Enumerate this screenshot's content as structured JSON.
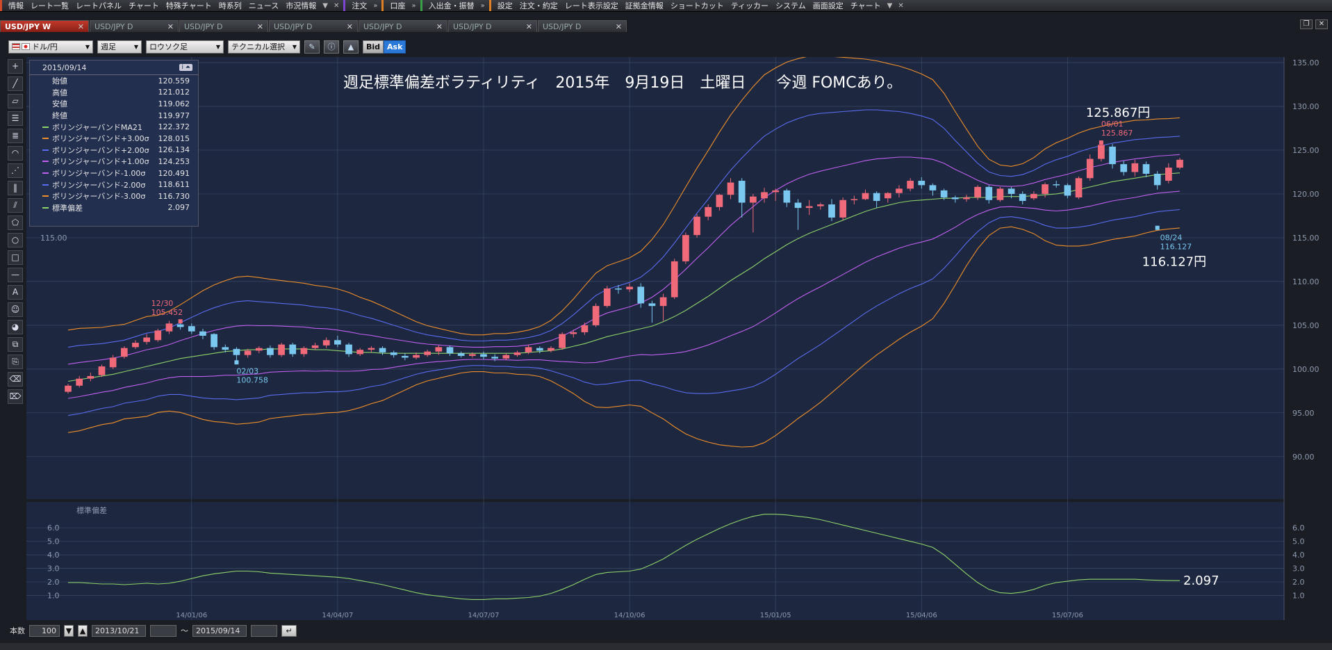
{
  "menubar": {
    "groups": [
      {
        "items": [
          "情報",
          "レート一覧",
          "レートパネル",
          "チャート",
          "特殊チャート",
          "時系列",
          "ニュース",
          "市況情報"
        ]
      },
      {
        "items": [
          "注文"
        ]
      },
      {
        "items": [
          "口座"
        ]
      },
      {
        "items": [
          "入出金・振替"
        ]
      },
      {
        "items": [
          "設定",
          "注文・約定",
          "レート表示設定",
          "証拠金情報",
          "ショートカット",
          "ティッカー",
          "システム",
          "画面設定",
          "チャート"
        ]
      }
    ]
  },
  "tabs": [
    {
      "label": "USD/JPY W",
      "active": true
    },
    {
      "label": "USD/JPY D",
      "active": false
    },
    {
      "label": "USD/JPY D",
      "active": false
    },
    {
      "label": "USD/JPY D",
      "active": false
    },
    {
      "label": "USD/JPY D",
      "active": false
    },
    {
      "label": "USD/JPY D",
      "active": false
    },
    {
      "label": "USD/JPY D",
      "active": false
    }
  ],
  "toolbar": {
    "pair": "ドル/円",
    "period": "週足",
    "chart_style": "ロウソク足",
    "technical": "テクニカル選択",
    "bid_label": "Bid",
    "ask_label": "Ask"
  },
  "infobox": {
    "date": "2015/09/14",
    "rows": [
      {
        "label": "始値",
        "value": "120.559",
        "color": ""
      },
      {
        "label": "高値",
        "value": "121.012",
        "color": ""
      },
      {
        "label": "安値",
        "value": "119.062",
        "color": ""
      },
      {
        "label": "終値",
        "value": "119.977",
        "color": ""
      },
      {
        "label": "ボリンジャーバンドMA21",
        "value": "122.372",
        "color": "#8fd46a"
      },
      {
        "label": "ボリンジャーバンド+3.00σ",
        "value": "128.015",
        "color": "#f0902a"
      },
      {
        "label": "ボリンジャーバンド+2.00σ",
        "value": "126.134",
        "color": "#5a6cf0"
      },
      {
        "label": "ボリンジャーバンド+1.00σ",
        "value": "124.253",
        "color": "#c060f0"
      },
      {
        "label": "ボリンジャーバンド-1.00σ",
        "value": "120.491",
        "color": "#c060f0"
      },
      {
        "label": "ボリンジャーバンド-2.00σ",
        "value": "118.611",
        "color": "#5a6cf0"
      },
      {
        "label": "ボリンジャーバンド-3.00σ",
        "value": "116.730",
        "color": "#f0902a"
      },
      {
        "label": "標準偏差",
        "value": "2.097",
        "color": "#8fd46a"
      }
    ]
  },
  "status": {
    "count_label": "本数",
    "count_value": "100",
    "from_date": "2013/10/21",
    "tilde": "～",
    "to_date": "2015/09/14"
  },
  "chart_data": {
    "type": "candlestick",
    "title": "週足標準偏差ボラティリティ　2015年　9月19日　土曜日　　今週 FOMCあり。",
    "ylim": [
      88,
      135
    ],
    "yticks": [
      "135.00",
      "130.00",
      "125.00",
      "120.00",
      "115.00",
      "110.00",
      "105.00",
      "100.00",
      "95.00",
      "90.00"
    ],
    "xticks": [
      "14/01/06",
      "14/04/07",
      "14/07/07",
      "14/10/06",
      "15/01/05",
      "15/04/06",
      "15/07/06"
    ],
    "candles": [
      [
        97.4,
        98.1,
        97.2,
        98.3
      ],
      [
        98.1,
        98.9,
        97.9,
        99.2
      ],
      [
        98.9,
        99.2,
        98.6,
        99.6
      ],
      [
        99.3,
        100.3,
        99.1,
        100.5
      ],
      [
        100.2,
        101.3,
        100.0,
        101.6
      ],
      [
        101.4,
        102.4,
        101.2,
        102.6
      ],
      [
        102.5,
        103.0,
        102.3,
        103.3
      ],
      [
        103.1,
        103.6,
        102.8,
        104.0
      ],
      [
        103.3,
        104.4,
        103.1,
        104.6
      ],
      [
        104.3,
        105.2,
        104.0,
        105.5
      ],
      [
        105.1,
        104.8,
        104.5,
        105.45
      ],
      [
        104.9,
        104.3,
        104.0,
        105.2
      ],
      [
        104.3,
        103.8,
        103.4,
        104.6
      ],
      [
        104.0,
        102.5,
        102.2,
        104.1
      ],
      [
        102.5,
        102.2,
        101.9,
        102.8
      ],
      [
        102.3,
        101.6,
        100.76,
        102.5
      ],
      [
        101.6,
        102.1,
        101.3,
        102.3
      ],
      [
        102.1,
        102.4,
        101.8,
        102.6
      ],
      [
        102.4,
        101.6,
        101.3,
        102.7
      ],
      [
        101.6,
        102.8,
        101.4,
        103.0
      ],
      [
        102.8,
        101.7,
        101.4,
        103.0
      ],
      [
        101.7,
        102.4,
        101.4,
        102.6
      ],
      [
        102.4,
        102.7,
        102.2,
        103.0
      ],
      [
        102.7,
        103.3,
        102.4,
        103.6
      ],
      [
        103.3,
        102.8,
        102.5,
        103.8
      ],
      [
        102.8,
        101.7,
        101.4,
        103.0
      ],
      [
        101.7,
        102.2,
        101.5,
        102.4
      ],
      [
        102.2,
        102.4,
        101.9,
        102.6
      ],
      [
        102.4,
        101.9,
        101.6,
        102.6
      ],
      [
        101.9,
        101.6,
        101.3,
        102.1
      ],
      [
        101.5,
        101.3,
        101.0,
        101.8
      ],
      [
        101.3,
        101.6,
        101.1,
        101.9
      ],
      [
        101.6,
        102.0,
        101.4,
        102.2
      ],
      [
        102.0,
        102.5,
        101.6,
        102.7
      ],
      [
        102.5,
        101.8,
        101.5,
        102.7
      ],
      [
        101.8,
        101.5,
        101.3,
        102.0
      ],
      [
        101.5,
        101.7,
        101.3,
        101.9
      ],
      [
        101.7,
        101.4,
        101.1,
        102.0
      ],
      [
        101.4,
        101.2,
        100.9,
        101.7
      ],
      [
        101.2,
        101.6,
        101.0,
        101.8
      ],
      [
        101.6,
        101.9,
        101.4,
        102.1
      ],
      [
        101.9,
        102.5,
        101.7,
        102.8
      ],
      [
        102.4,
        102.1,
        101.8,
        102.6
      ],
      [
        102.1,
        102.4,
        101.9,
        102.6
      ],
      [
        102.4,
        104.0,
        102.2,
        104.2
      ],
      [
        104.0,
        104.2,
        103.6,
        104.5
      ],
      [
        104.2,
        105.0,
        103.9,
        105.3
      ],
      [
        105.0,
        107.2,
        104.8,
        107.5
      ],
      [
        107.2,
        109.2,
        107.0,
        109.5
      ],
      [
        109.2,
        109.1,
        108.6,
        109.6
      ],
      [
        109.1,
        109.4,
        108.8,
        109.8
      ],
      [
        109.4,
        107.5,
        107.0,
        109.8
      ],
      [
        107.5,
        107.2,
        105.3,
        107.8
      ],
      [
        107.2,
        108.2,
        105.5,
        108.6
      ],
      [
        108.2,
        112.3,
        108.0,
        112.6
      ],
      [
        112.3,
        115.3,
        112.0,
        115.6
      ],
      [
        115.3,
        117.4,
        115.0,
        117.7
      ],
      [
        117.4,
        118.5,
        117.0,
        118.8
      ],
      [
        118.5,
        119.9,
        118.1,
        120.0
      ],
      [
        119.9,
        121.3,
        119.4,
        121.8
      ],
      [
        121.5,
        119.0,
        117.3,
        121.8
      ],
      [
        119.0,
        119.7,
        115.6,
        120.0
      ],
      [
        119.5,
        120.2,
        119.0,
        120.7
      ],
      [
        120.2,
        120.4,
        119.2,
        120.6
      ],
      [
        120.4,
        119.0,
        118.5,
        120.6
      ],
      [
        119.0,
        118.4,
        115.9,
        119.4
      ],
      [
        118.4,
        118.6,
        117.6,
        119.3
      ],
      [
        118.6,
        118.8,
        118.2,
        119.0
      ],
      [
        118.8,
        117.3,
        116.9,
        119.4
      ],
      [
        117.3,
        119.3,
        117.0,
        119.6
      ],
      [
        119.3,
        119.4,
        118.8,
        119.8
      ],
      [
        119.4,
        120.1,
        119.3,
        120.5
      ],
      [
        120.1,
        119.2,
        118.4,
        120.3
      ],
      [
        119.5,
        120.1,
        119.0,
        120.2
      ],
      [
        120.1,
        120.6,
        119.6,
        121.0
      ],
      [
        120.6,
        121.5,
        120.3,
        121.8
      ],
      [
        121.5,
        121.0,
        120.6,
        121.9
      ],
      [
        121.0,
        120.4,
        119.8,
        121.2
      ],
      [
        120.4,
        119.6,
        119.3,
        120.6
      ],
      [
        119.6,
        119.4,
        119.0,
        119.8
      ],
      [
        119.4,
        119.6,
        119.1,
        119.9
      ],
      [
        119.6,
        120.8,
        119.3,
        121.0
      ],
      [
        120.8,
        119.3,
        118.9,
        121.0
      ],
      [
        119.3,
        120.6,
        119.1,
        120.8
      ],
      [
        120.6,
        120.0,
        119.5,
        120.8
      ],
      [
        120.0,
        119.2,
        118.8,
        120.3
      ],
      [
        119.5,
        120.0,
        119.3,
        120.3
      ],
      [
        120.0,
        121.1,
        119.6,
        121.3
      ],
      [
        121.1,
        121.0,
        120.7,
        121.5
      ],
      [
        121.0,
        119.8,
        119.5,
        121.2
      ],
      [
        119.6,
        121.8,
        119.4,
        122.0
      ],
      [
        121.8,
        124.0,
        121.5,
        124.5
      ],
      [
        124.0,
        125.6,
        123.7,
        125.867
      ],
      [
        125.4,
        123.4,
        122.9,
        125.7
      ],
      [
        123.4,
        122.5,
        122.1,
        123.8
      ],
      [
        122.5,
        123.5,
        122.0,
        123.9
      ],
      [
        123.4,
        122.3,
        121.9,
        123.7
      ],
      [
        122.3,
        121.0,
        120.5,
        122.6
      ],
      [
        121.5,
        123.0,
        121.2,
        123.5
      ],
      [
        123.0,
        123.9,
        122.8,
        124.1
      ]
    ],
    "ma21": [
      98.6,
      98.8,
      99.0,
      99.2,
      99.4,
      99.7,
      100.0,
      100.3,
      100.6,
      100.9,
      101.2,
      101.4,
      101.6,
      101.8,
      102.0,
      102.1,
      102.2,
      102.2,
      102.3,
      102.3,
      102.3,
      102.3,
      102.2,
      102.2,
      102.1,
      102.0,
      101.9,
      101.9,
      101.8,
      101.8,
      101.8,
      101.8,
      101.8,
      101.8,
      101.8,
      101.8,
      101.8,
      101.8,
      101.8,
      101.8,
      101.8,
      101.9,
      102.0,
      102.1,
      102.3,
      102.6,
      102.9,
      103.3,
      103.7,
      104.0,
      104.3,
      104.6,
      104.9,
      105.4,
      106.0,
      106.7,
      107.5,
      108.3,
      109.2,
      110.1,
      110.9,
      111.7,
      112.6,
      113.4,
      114.2,
      114.9,
      115.5,
      116.0,
      116.5,
      117.0,
      117.5,
      118.0,
      118.4,
      118.7,
      119.0,
      119.2,
      119.3,
      119.4,
      119.5,
      119.5,
      119.6,
      119.6,
      119.6,
      119.7,
      119.7,
      119.7,
      119.8,
      119.9,
      120.0,
      120.2,
      120.5,
      120.8,
      121.1,
      121.4,
      121.6,
      121.8,
      122.0,
      122.2,
      122.3,
      122.4
    ],
    "stddev": [
      1.95,
      1.95,
      1.9,
      1.85,
      1.85,
      1.8,
      1.85,
      1.9,
      1.85,
      1.9,
      2.05,
      2.25,
      2.45,
      2.6,
      2.7,
      2.8,
      2.8,
      2.75,
      2.65,
      2.6,
      2.55,
      2.5,
      2.45,
      2.4,
      2.35,
      2.25,
      2.1,
      1.95,
      1.8,
      1.6,
      1.4,
      1.2,
      1.05,
      0.95,
      0.85,
      0.75,
      0.7,
      0.7,
      0.75,
      0.75,
      0.8,
      0.85,
      0.95,
      1.15,
      1.45,
      1.8,
      2.2,
      2.55,
      2.7,
      2.75,
      2.8,
      2.95,
      3.3,
      3.7,
      4.2,
      4.7,
      5.15,
      5.55,
      5.95,
      6.3,
      6.6,
      6.85,
      7.0,
      7.0,
      6.95,
      6.85,
      6.75,
      6.6,
      6.4,
      6.2,
      6.0,
      5.8,
      5.6,
      5.4,
      5.2,
      5.0,
      4.8,
      4.55,
      4.0,
      3.3,
      2.6,
      1.95,
      1.45,
      1.2,
      1.15,
      1.25,
      1.45,
      1.75,
      1.95,
      2.05,
      2.15,
      2.2,
      2.2,
      2.2,
      2.2,
      2.2,
      2.15,
      2.12,
      2.1,
      2.097
    ],
    "indicator": {
      "name": "標準偏差",
      "ylim": [
        0,
        7.5
      ],
      "yticks": [
        "6.0",
        "5.0",
        "4.0",
        "3.0",
        "2.0",
        "1.0"
      ],
      "last_label": "2.097"
    },
    "annotations": {
      "hi1": {
        "date": "12/30",
        "value": "105.452"
      },
      "lo1": {
        "date": "02/03",
        "value": "100.758"
      },
      "hi2": {
        "date": "06/01",
        "value": "125.867"
      },
      "lo2": {
        "date": "08/24",
        "value": "116.127"
      },
      "hi2_big": "125.867円",
      "lo2_big": "116.127円"
    },
    "colors": {
      "up": "#f06a7a",
      "down": "#7ac8ef",
      "ma": "#8fd46a",
      "s1": "#c060f0",
      "s2": "#5a6cf0",
      "s3": "#f0902a",
      "bg": "#1d2740",
      "grid": "#3a4a66"
    }
  }
}
